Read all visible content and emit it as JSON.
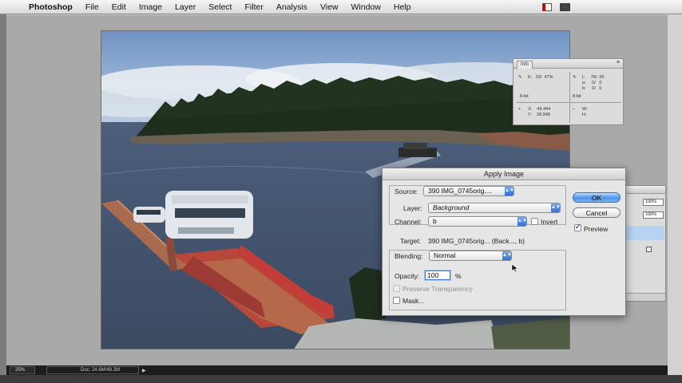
{
  "menubar": {
    "app": "Photoshop",
    "items": [
      "File",
      "Edit",
      "Image",
      "Layer",
      "Select",
      "Filter",
      "Analysis",
      "View",
      "Window",
      "Help"
    ],
    "apple_icon": "apple-icon"
  },
  "status": {
    "zoom": "25%",
    "doc": "Doc: 24.6M/49.2M"
  },
  "info_panel": {
    "tab": "Info",
    "rgb_r": "K:   33/  47%",
    "rgb_g": "",
    "bit_left": "8-bit",
    "lab_l": "L:    76/  65",
    "lab_a": "a:     0/   0",
    "lab_b": "b:     0/   0",
    "bit_right": "8-bit",
    "x": "X:    49.444",
    "y": "Y:    28.948",
    "w": "W:",
    "h": "H:"
  },
  "layers_panel": {
    "opacity": "100%",
    "fill": "100%"
  },
  "dialog": {
    "title": "Apply Image",
    "source_label": "Source:",
    "source_value": "390 IMG_0745orig....",
    "layer_label": "Layer:",
    "layer_value": "Background",
    "channel_label": "Channel:",
    "channel_value": "b",
    "invert_label": "Invert",
    "target_label": "Target:",
    "target_value": "390 IMG_0745orig... (Back..., b)",
    "blending_label": "Blending:",
    "blending_value": "Normal",
    "opacity_label": "Opacity:",
    "opacity_value": "100",
    "opacity_unit": "%",
    "preserve_label": "Preserve Transparency",
    "mask_label": "Mask...",
    "ok_label": "OK",
    "cancel_label": "Cancel",
    "preview_label": "Preview",
    "preview_checked": true,
    "invert_checked": false
  },
  "colors": {
    "ok_button": "#4e93ea",
    "dropdown_arrow": "#2f6ad3",
    "deck_red": "#b8473b"
  }
}
